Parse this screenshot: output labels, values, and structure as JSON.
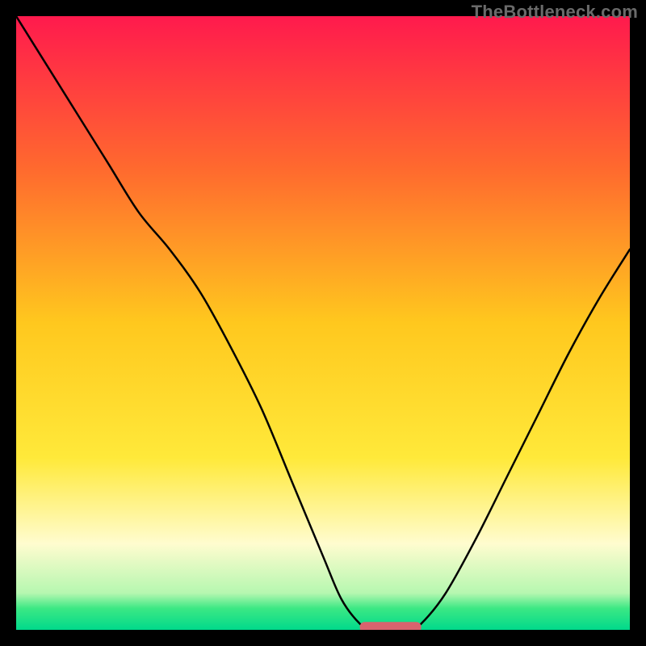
{
  "attribution": "TheBottleneck.com",
  "chart_data": {
    "type": "line",
    "title": "",
    "xlabel": "",
    "ylabel": "",
    "xlim": [
      0,
      100
    ],
    "ylim": [
      0,
      100
    ],
    "background_gradient": {
      "stops": [
        {
          "pos": 0.0,
          "color": "#ff1a4d"
        },
        {
          "pos": 0.25,
          "color": "#ff6a2e"
        },
        {
          "pos": 0.5,
          "color": "#ffc81e"
        },
        {
          "pos": 0.72,
          "color": "#ffe93a"
        },
        {
          "pos": 0.86,
          "color": "#fffccf"
        },
        {
          "pos": 0.94,
          "color": "#b6f7b0"
        },
        {
          "pos": 0.965,
          "color": "#3ce884"
        },
        {
          "pos": 1.0,
          "color": "#00d98b"
        }
      ]
    },
    "series": [
      {
        "name": "left-curve",
        "x": [
          0,
          5,
          10,
          15,
          20,
          25,
          30,
          35,
          40,
          45,
          50,
          53,
          56,
          58
        ],
        "y": [
          100,
          92,
          84,
          76,
          68,
          62,
          55,
          46,
          36,
          24,
          12,
          5,
          1,
          0
        ]
      },
      {
        "name": "right-curve",
        "x": [
          64,
          66,
          70,
          75,
          80,
          85,
          90,
          95,
          100
        ],
        "y": [
          0,
          1,
          6,
          15,
          25,
          35,
          45,
          54,
          62
        ]
      }
    ],
    "marker": {
      "name": "bottleneck-marker",
      "x_start": 56,
      "x_end": 66,
      "y": 0.5,
      "color": "#d9636e"
    }
  }
}
